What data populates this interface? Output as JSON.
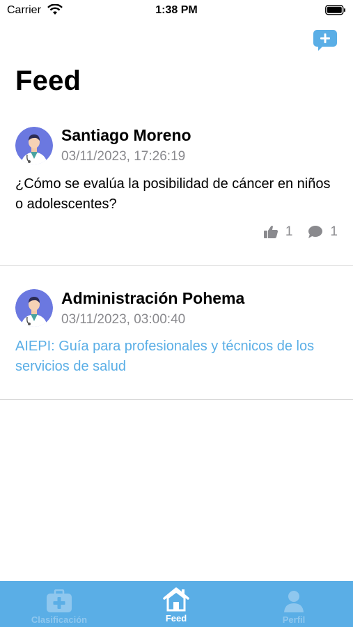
{
  "status_bar": {
    "carrier": "Carrier",
    "time": "1:38 PM"
  },
  "header": {
    "title": "Feed"
  },
  "posts": [
    {
      "author": "Santiago Moreno",
      "date": "03/11/2023, 17:26:19",
      "text": "¿Cómo se evalúa la posibilidad de cáncer en niños o adolescentes?",
      "likes": "1",
      "comments": "1"
    },
    {
      "author": "Administración Pohema",
      "date": "03/11/2023, 03:00:40",
      "text": "AIEPI: Guía para profesionales y técnicos de los servicios de salud"
    }
  ],
  "tabbar": {
    "tabs": [
      {
        "label": "Clasificación",
        "icon": "medical-kit-icon"
      },
      {
        "label": "Feed",
        "icon": "home-icon"
      },
      {
        "label": "Perfil",
        "icon": "person-icon"
      }
    ],
    "active": "Feed"
  },
  "colors": {
    "accent": "#5aaee6",
    "secondary_text": "#8a8a8e",
    "avatar_bg": "#6b78e0"
  }
}
